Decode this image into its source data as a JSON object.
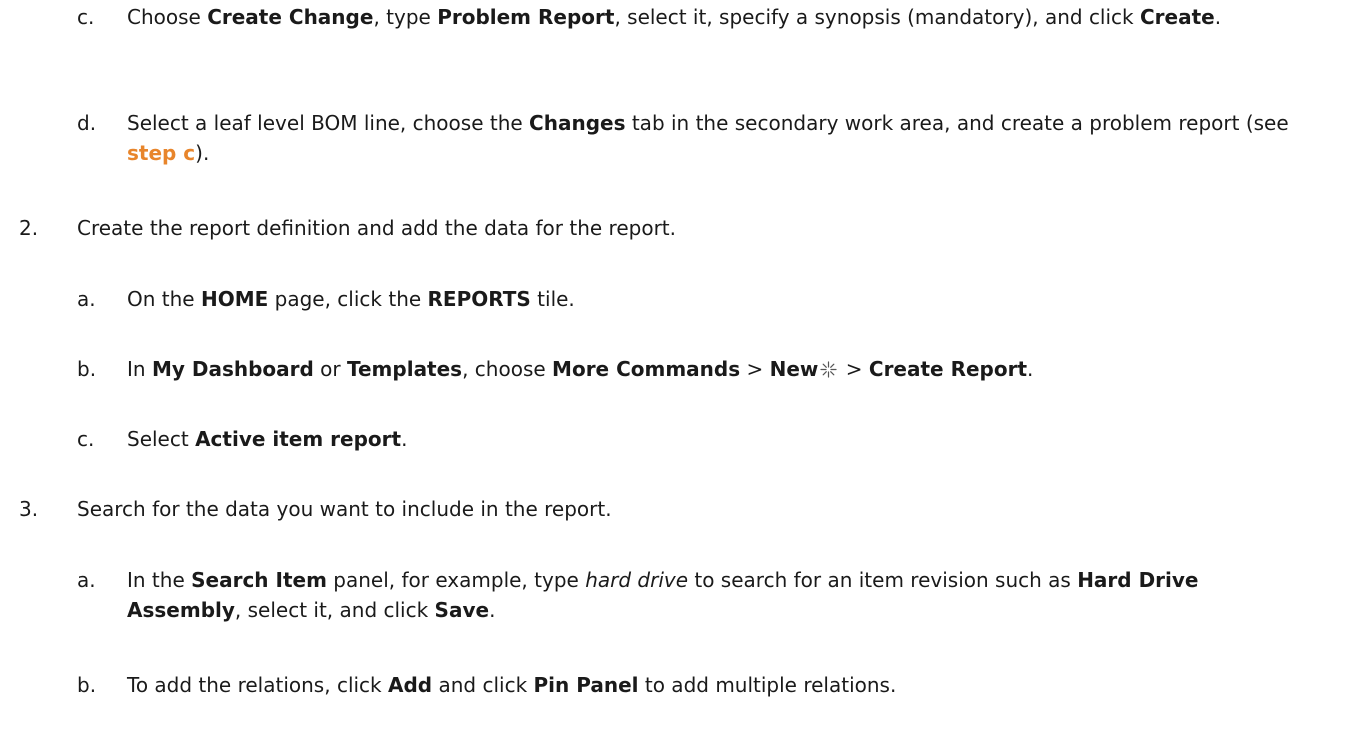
{
  "steps": [
    {
      "label": "c.",
      "t1": "Choose ",
      "b1": "Create Change",
      "t2": ", type ",
      "b2": "Problem Report",
      "t3": ", select it, specify a synopsis (mandatory), and click ",
      "b3": "Create",
      "t4": "."
    },
    {
      "label": "d.",
      "t1": "Select a leaf level BOM line, choose the ",
      "b1": "Changes",
      "t2": " tab in the secondary work area, and create a problem report (see ",
      "link": "step c",
      "t3": ")."
    },
    {
      "label": "2.",
      "text": "Create the report definition and add the data for the report."
    },
    {
      "label": "a.",
      "t1": "On the ",
      "b1": "HOME",
      "t2": " page, click the ",
      "b2": "REPORTS",
      "t3": " tile."
    },
    {
      "label": "b.",
      "t1": "In ",
      "b1": "My Dashboard",
      "t2": " or ",
      "b2": "Templates",
      "t3": ", choose ",
      "b3": "More Commands",
      "t4": " > ",
      "b4": "New",
      "t5": " > ",
      "b5": "Create Report",
      "t6": "."
    },
    {
      "label": "c.",
      "t1": "Select ",
      "b1": "Active item report",
      "t2": "."
    },
    {
      "label": "3.",
      "text": "Search for the data you want to include in the report."
    },
    {
      "label": "a.",
      "t1": "In the ",
      "b1": "Search Item",
      "t2": " panel, for example, type ",
      "i1": "hard drive",
      "t3": " to search for an item revision such as ",
      "b2": "Hard Drive Assembly",
      "t4": ", select it, and click ",
      "b3": "Save",
      "t5": "."
    },
    {
      "label": "b.",
      "t1": "To add the relations, click ",
      "b1": "Add",
      "t2": " and click ",
      "b2": "Pin Panel",
      "t3": " to add multiple relations."
    }
  ],
  "icons": {
    "new": "new-sparkle-icon"
  }
}
